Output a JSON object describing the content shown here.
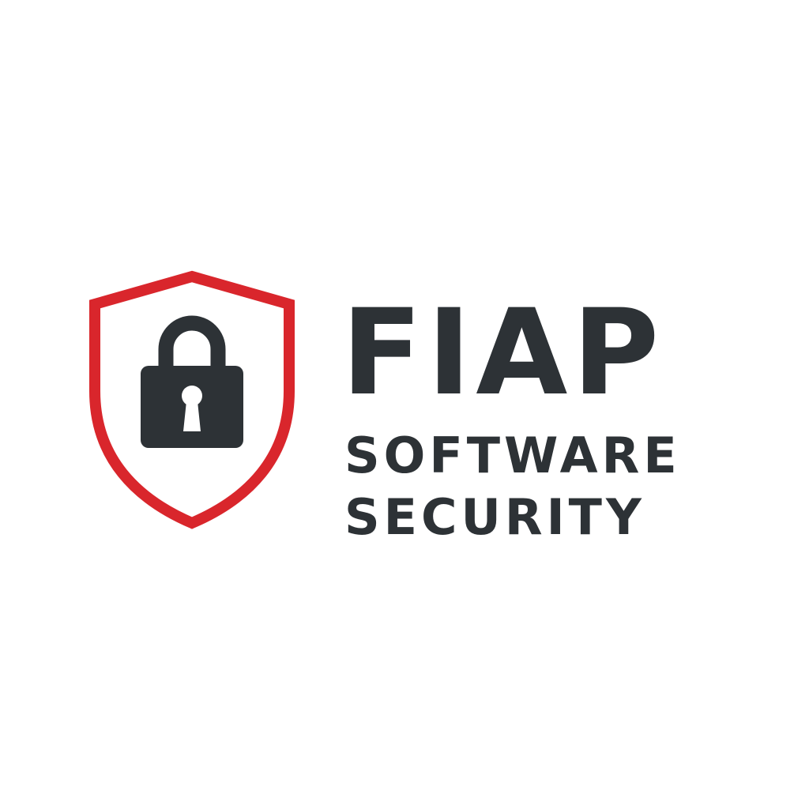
{
  "brand": {
    "name": "FIAP",
    "tagline_line1": "SOFTWARE",
    "tagline_line2": "SECURITY"
  },
  "icons": {
    "shield": "shield-icon",
    "lock": "padlock-icon"
  },
  "colors": {
    "background": "#ffffff",
    "text": "#2d3236",
    "shield_outline": "#d9262c",
    "lock_body": "#2d3236",
    "keyhole": "#ffffff"
  }
}
